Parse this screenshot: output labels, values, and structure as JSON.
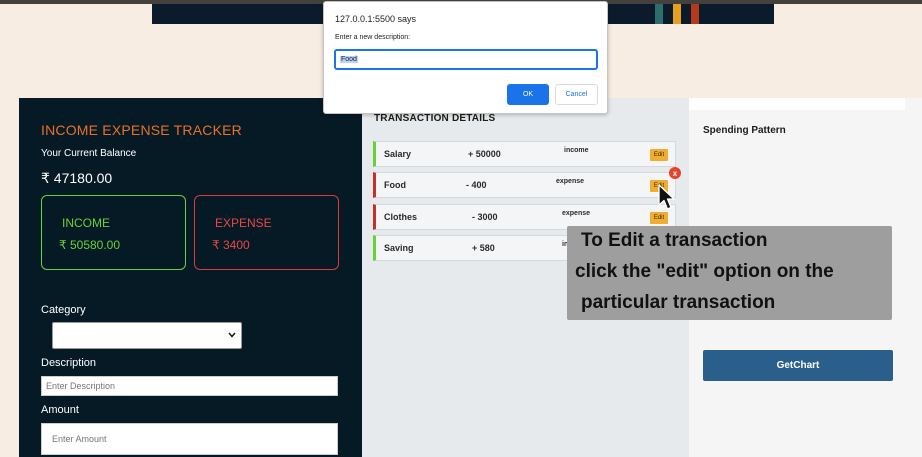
{
  "banner": {
    "stripe_colors": [
      "#2b6f6a",
      "#e6a01f",
      "#b53a1d"
    ]
  },
  "tracker": {
    "title": "INCOME EXPENSE TRACKER",
    "balance_label": "Your Current Balance",
    "balance_value": "₹ 47180.00",
    "income": {
      "label": "INCOME",
      "value": "₹ 50580.00",
      "color": "#66d238"
    },
    "expense": {
      "label": "EXPENSE",
      "value": "₹ 3400",
      "color": "#e94545"
    },
    "category_label": "Category",
    "category_selected": "",
    "description_label": "Description",
    "description_placeholder": "Enter Description",
    "amount_label": "Amount",
    "amount_placeholder": "Enter Amount"
  },
  "transactions": {
    "title": "TRANSACTION DETAILS",
    "edit_label": "Edit",
    "delete_label": "x",
    "rows": [
      {
        "name": "Salary",
        "amount": "+ 50000",
        "type": "income"
      },
      {
        "name": "Food",
        "amount": "- 400",
        "type": "expense"
      },
      {
        "name": "Clothes",
        "amount": "- 3000",
        "type": "expense"
      },
      {
        "name": "Saving",
        "amount": "+ 580",
        "type": "in"
      }
    ]
  },
  "chart": {
    "title": "Spending Pattern",
    "button_label": "GetChart"
  },
  "tooltip": {
    "line1": "To Edit a transaction",
    "line2": "click the \"edit\" option on the",
    "line3": "particular transaction"
  },
  "dialog": {
    "origin": "127.0.0.1:5500 says",
    "message": "Enter a new description:",
    "input_value": "Food",
    "ok_label": "OK",
    "cancel_label": "Cancel"
  }
}
